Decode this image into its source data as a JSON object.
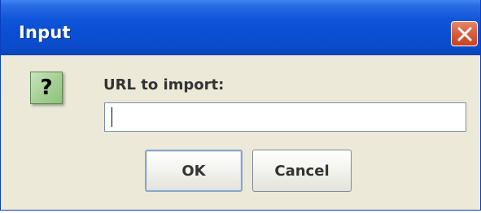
{
  "dialog": {
    "title": "Input",
    "close_icon": "close-x-icon",
    "icon": "question-icon",
    "icon_glyph": "?",
    "prompt_label": "URL to import:",
    "url_input": {
      "value": "",
      "placeholder": ""
    },
    "ok_label": "OK",
    "cancel_label": "Cancel"
  },
  "colors": {
    "titlebar": "#0a4ed3",
    "close_button": "#d9603e",
    "dialog_background": "#ece9d8",
    "question_icon": "#a7d197"
  }
}
